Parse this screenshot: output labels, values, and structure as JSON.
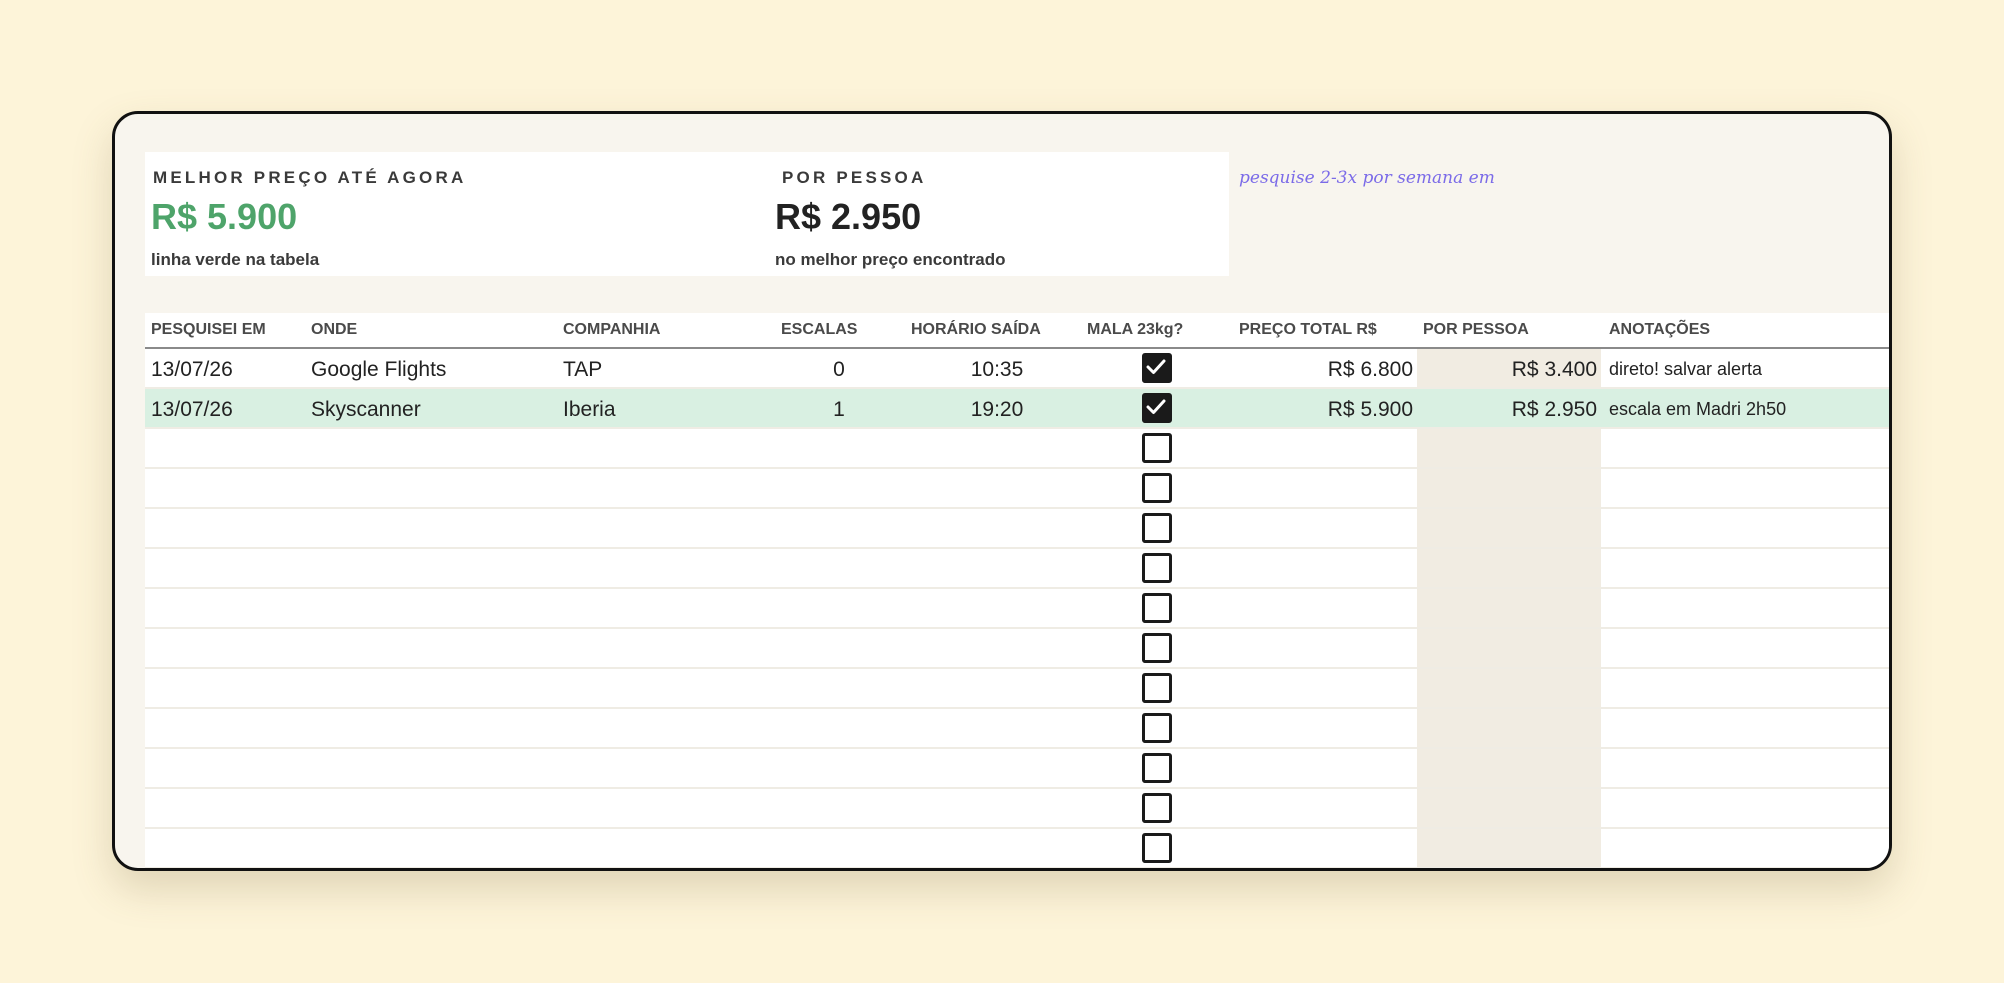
{
  "summary": {
    "best_label": "MELHOR PREÇO ATÉ AGORA",
    "best_value": "R$ 5.900",
    "best_sub": "linha verde na tabela",
    "pp_label": "POR PESSOA",
    "pp_value": "R$ 2.950",
    "pp_sub": "no melhor preço encontrado"
  },
  "note": "pesquise 2-3x por semana em",
  "table": {
    "headers": {
      "date": "PESQUISEI EM",
      "where": "ONDE",
      "airline": "COMPANHIA",
      "stops": "ESCALAS",
      "time": "HORÁRIO SAÍDA",
      "bag": "MALA 23kg?",
      "total": "PREÇO TOTAL R$",
      "per_person": "POR PESSOA",
      "notes": "ANOTAÇÕES"
    },
    "rows": [
      {
        "date": "13/07/26",
        "where": "Google Flights",
        "airline": "TAP",
        "stops": "0",
        "time": "10:35",
        "bag": true,
        "total": "R$ 6.800",
        "per_person": "R$ 3.400",
        "notes": "direto! salvar alerta",
        "best": false
      },
      {
        "date": "13/07/26",
        "where": "Skyscanner",
        "airline": "Iberia",
        "stops": "1",
        "time": "19:20",
        "bag": true,
        "total": "R$ 5.900",
        "per_person": "R$ 2.950",
        "notes": "escala em Madri 2h50",
        "best": true
      },
      {
        "date": "",
        "where": "",
        "airline": "",
        "stops": "",
        "time": "",
        "bag": false,
        "total": "",
        "per_person": "",
        "notes": "",
        "best": false
      },
      {
        "date": "",
        "where": "",
        "airline": "",
        "stops": "",
        "time": "",
        "bag": false,
        "total": "",
        "per_person": "",
        "notes": "",
        "best": false
      },
      {
        "date": "",
        "where": "",
        "airline": "",
        "stops": "",
        "time": "",
        "bag": false,
        "total": "",
        "per_person": "",
        "notes": "",
        "best": false
      },
      {
        "date": "",
        "where": "",
        "airline": "",
        "stops": "",
        "time": "",
        "bag": false,
        "total": "",
        "per_person": "",
        "notes": "",
        "best": false
      },
      {
        "date": "",
        "where": "",
        "airline": "",
        "stops": "",
        "time": "",
        "bag": false,
        "total": "",
        "per_person": "",
        "notes": "",
        "best": false
      },
      {
        "date": "",
        "where": "",
        "airline": "",
        "stops": "",
        "time": "",
        "bag": false,
        "total": "",
        "per_person": "",
        "notes": "",
        "best": false
      },
      {
        "date": "",
        "where": "",
        "airline": "",
        "stops": "",
        "time": "",
        "bag": false,
        "total": "",
        "per_person": "",
        "notes": "",
        "best": false
      },
      {
        "date": "",
        "where": "",
        "airline": "",
        "stops": "",
        "time": "",
        "bag": false,
        "total": "",
        "per_person": "",
        "notes": "",
        "best": false
      },
      {
        "date": "",
        "where": "",
        "airline": "",
        "stops": "",
        "time": "",
        "bag": false,
        "total": "",
        "per_person": "",
        "notes": "",
        "best": false
      },
      {
        "date": "",
        "where": "",
        "airline": "",
        "stops": "",
        "time": "",
        "bag": false,
        "total": "",
        "per_person": "",
        "notes": "",
        "best": false
      },
      {
        "date": "",
        "where": "",
        "airline": "",
        "stops": "",
        "time": "",
        "bag": false,
        "total": "",
        "per_person": "",
        "notes": "",
        "best": false
      }
    ]
  },
  "colors": {
    "background": "#fdf4d9",
    "best_price": "#4ea46a",
    "best_row": "#d9f0e2",
    "note": "#7b6be8"
  }
}
